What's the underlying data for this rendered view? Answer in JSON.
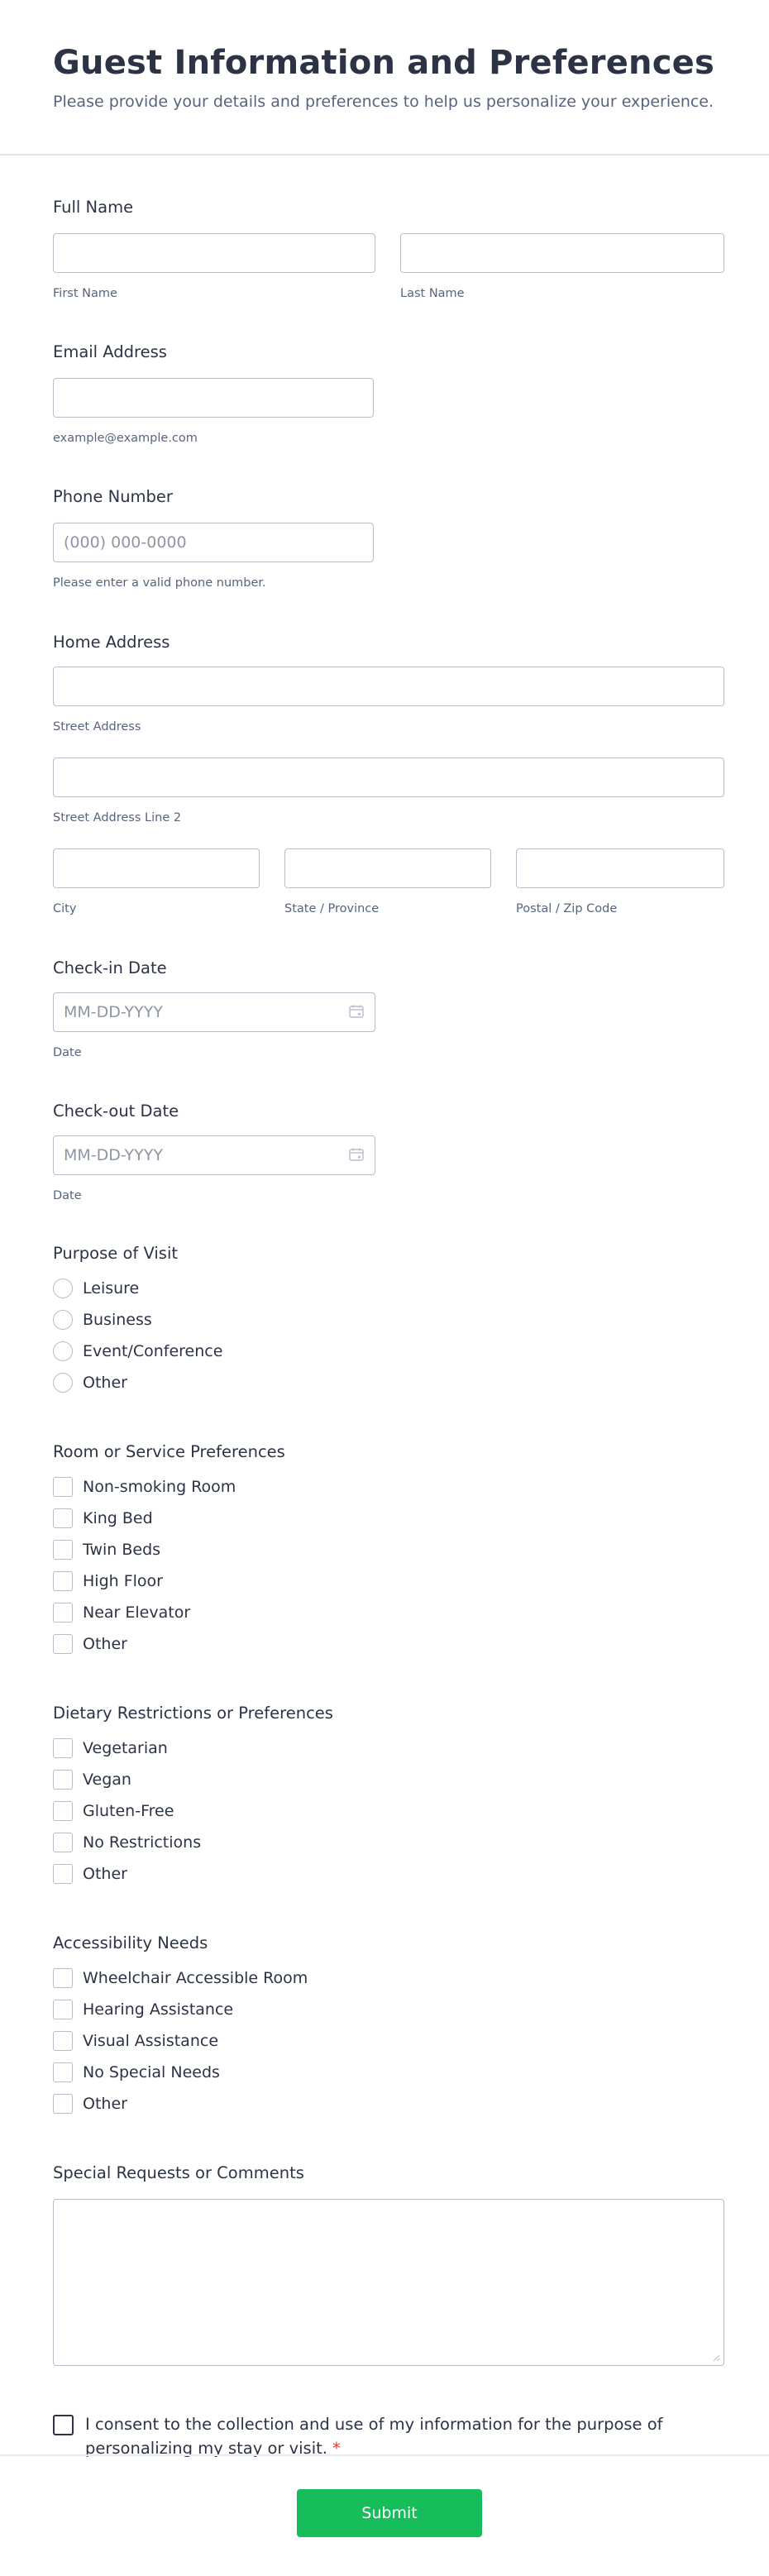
{
  "header": {
    "title": "Guest Information and Preferences",
    "subtitle": "Please provide your details and preferences to help us personalize your experience."
  },
  "full_name": {
    "label": "Full Name",
    "first_sublabel": "First Name",
    "last_sublabel": "Last Name",
    "first_value": "",
    "last_value": ""
  },
  "email": {
    "label": "Email Address",
    "sublabel": "example@example.com",
    "value": ""
  },
  "phone": {
    "label": "Phone Number",
    "placeholder": "(000) 000-0000",
    "sublabel": "Please enter a valid phone number."
  },
  "address": {
    "label": "Home Address",
    "street_sublabel": "Street Address",
    "street2_sublabel": "Street Address Line 2",
    "city_sublabel": "City",
    "state_sublabel": "State / Province",
    "zip_sublabel": "Postal / Zip Code"
  },
  "checkin": {
    "label": "Check-in Date",
    "placeholder": "MM-DD-YYYY",
    "sublabel": "Date",
    "icon": "calendar-icon"
  },
  "checkout": {
    "label": "Check-out Date",
    "placeholder": "MM-DD-YYYY",
    "sublabel": "Date",
    "icon": "calendar-icon"
  },
  "purpose": {
    "label": "Purpose of Visit",
    "options": [
      "Leisure",
      "Business",
      "Event/Conference",
      "Other"
    ]
  },
  "room": {
    "label": "Room or Service Preferences",
    "options": [
      "Non-smoking Room",
      "King Bed",
      "Twin Beds",
      "High Floor",
      "Near Elevator",
      "Other"
    ]
  },
  "dietary": {
    "label": "Dietary Restrictions or Preferences",
    "options": [
      "Vegetarian",
      "Vegan",
      "Gluten-Free",
      "No Restrictions",
      "Other"
    ]
  },
  "accessibility": {
    "label": "Accessibility Needs",
    "options": [
      "Wheelchair Accessible Room",
      "Hearing Assistance",
      "Visual Assistance",
      "No Special Needs",
      "Other"
    ]
  },
  "requests": {
    "label": "Special Requests or Comments",
    "value": ""
  },
  "consent": {
    "text": "I consent to the collection and use of my information for the purpose of personalizing my stay or visit.",
    "required_mark": "*"
  },
  "submit": {
    "label": "Submit"
  },
  "colors": {
    "submit_bg": "#18bd5b",
    "required": "#e3342f",
    "text": "#2c3345",
    "sublabel": "#57647e",
    "border": "#b8bdc9"
  }
}
